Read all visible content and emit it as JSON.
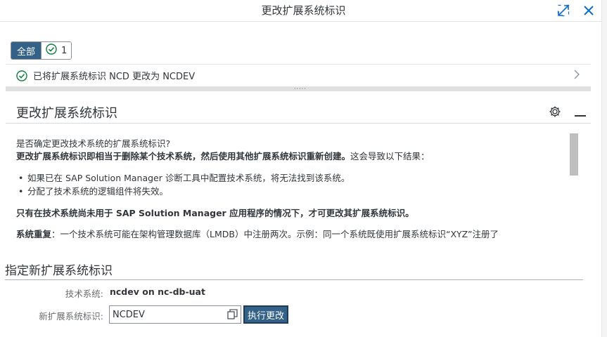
{
  "dialog": {
    "title": "更改扩展系统标识",
    "expand_icon": "expand-icon",
    "close_icon": "close-icon"
  },
  "filter": {
    "all_label": "全部",
    "success_count": "1",
    "success_icon": "check-circle-icon"
  },
  "message": {
    "text": "已将扩展系统标识 NCD 更改为 NCDEV",
    "icon": "check-circle-icon"
  },
  "section": {
    "title": "更改扩展系统标识",
    "p1": "是否确定更改技术系统的扩展系统标识?",
    "p2_bold": "更改扩展系统标识即相当于删除某个技术系统，然后使用其他扩展系统标识重新创建。",
    "p2_rest": "这会导致以下结果：",
    "bullets": [
      "如果已在 SAP Solution Manager 诊断工具中配置技术系统，将无法找到该系统。",
      "分配了技术系统的逻辑组件将失效。"
    ],
    "p3": "只有在技术系统尚未用于 SAP Solution Manager 应用程序的情况下，才可更改其扩展系统标识。",
    "p4_bold": "系统重复",
    "p4_rest": "：一个技术系统可能在架构管理数据库（LMDB）中注册两次。示例：同一个系统既使用扩展系统标识“XYZ”注册了"
  },
  "form": {
    "title": "指定新扩展系统标识",
    "tech_system_label": "技术系统:",
    "tech_system_value": "ncdev on nc-db-uat",
    "new_id_label": "新扩展系统标识:",
    "new_id_value": "NCDEV",
    "execute_label": "执行更改"
  },
  "colors": {
    "accent": "#346187",
    "success": "#107e3e",
    "link": "#0a6ed1"
  }
}
